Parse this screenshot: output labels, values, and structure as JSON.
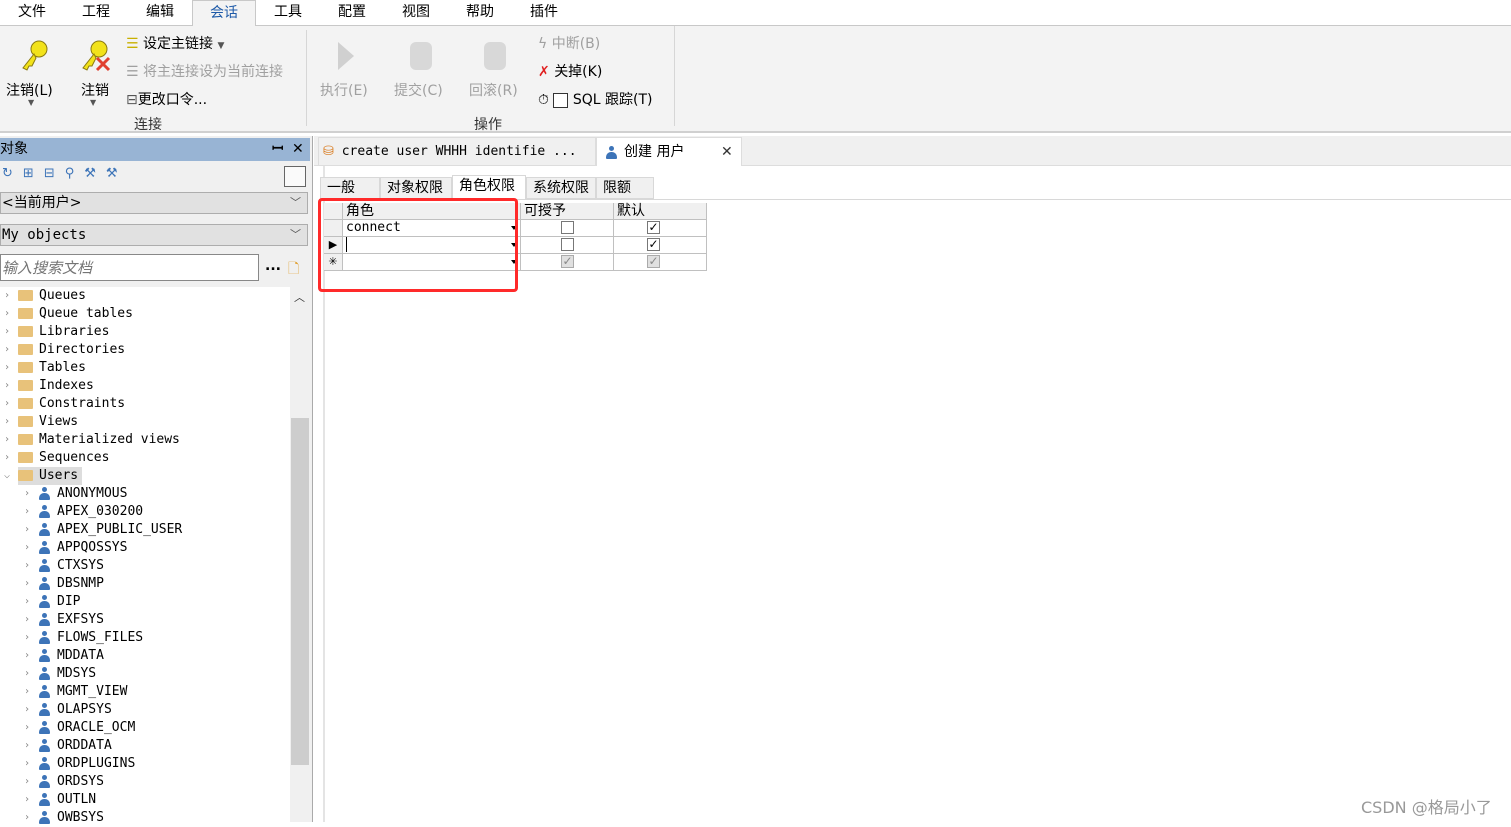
{
  "menu": [
    "文件",
    "工程",
    "编辑",
    "会话",
    "工具",
    "配置",
    "视图",
    "帮助",
    "插件"
  ],
  "active_menu": "会话",
  "ribbon": {
    "logoff_l": "注销(L)",
    "logoff": "注销",
    "set_main": "设定主链接",
    "set_main_current": "将主连接设为当前连接",
    "change_pwd": "更改口令...",
    "group_connect": "连接",
    "execute": "执行(E)",
    "commit": "提交(C)",
    "rollback": "回滚(R)",
    "break": "中断(B)",
    "kill": "关掉(K)",
    "sql_trace": "SQL 跟踪(T)",
    "sql_trace_checked": false,
    "group_ops": "操作"
  },
  "objects_panel": {
    "title": "对象",
    "pin": "ꟷ",
    "close": "✕",
    "user_combo": "<当前用户>",
    "filter_combo": "My objects",
    "search_placeholder": "输入搜索文档",
    "more": "...",
    "folders": [
      "Queues",
      "Queue tables",
      "Libraries",
      "Directories",
      "Tables",
      "Indexes",
      "Constraints",
      "Views",
      "Materialized views",
      "Sequences",
      "Users"
    ],
    "users": [
      "ANONYMOUS",
      "APEX_030200",
      "APEX_PUBLIC_USER",
      "APPQOSSYS",
      "CTXSYS",
      "DBSNMP",
      "DIP",
      "EXFSYS",
      "FLOWS_FILES",
      "MDDATA",
      "MDSYS",
      "MGMT_VIEW",
      "OLAPSYS",
      "ORACLE_OCM",
      "ORDDATA",
      "ORDPLUGINS",
      "ORDSYS",
      "OUTLN",
      "OWBSYS"
    ]
  },
  "doc_tabs": [
    {
      "label": "create user WHHH identifie ..."
    },
    {
      "label": "创建 用户",
      "close": "✕"
    }
  ],
  "sub_tabs": [
    "一般",
    "对象权限",
    "角色权限",
    "系统权限",
    "限额"
  ],
  "active_sub_tab": "角色权限",
  "grid": {
    "headers": [
      "角色",
      "可授予",
      "默认"
    ],
    "rows": [
      {
        "indicator": "",
        "role": "connect",
        "grantable": false,
        "default": true
      },
      {
        "indicator": "▶",
        "role": "",
        "grantable": false,
        "default": true
      },
      {
        "indicator": "✳",
        "role": "",
        "grantable": null,
        "default": null
      }
    ]
  },
  "highlight_color": "#ff2a2a",
  "watermark": "CSDN @格局小了"
}
